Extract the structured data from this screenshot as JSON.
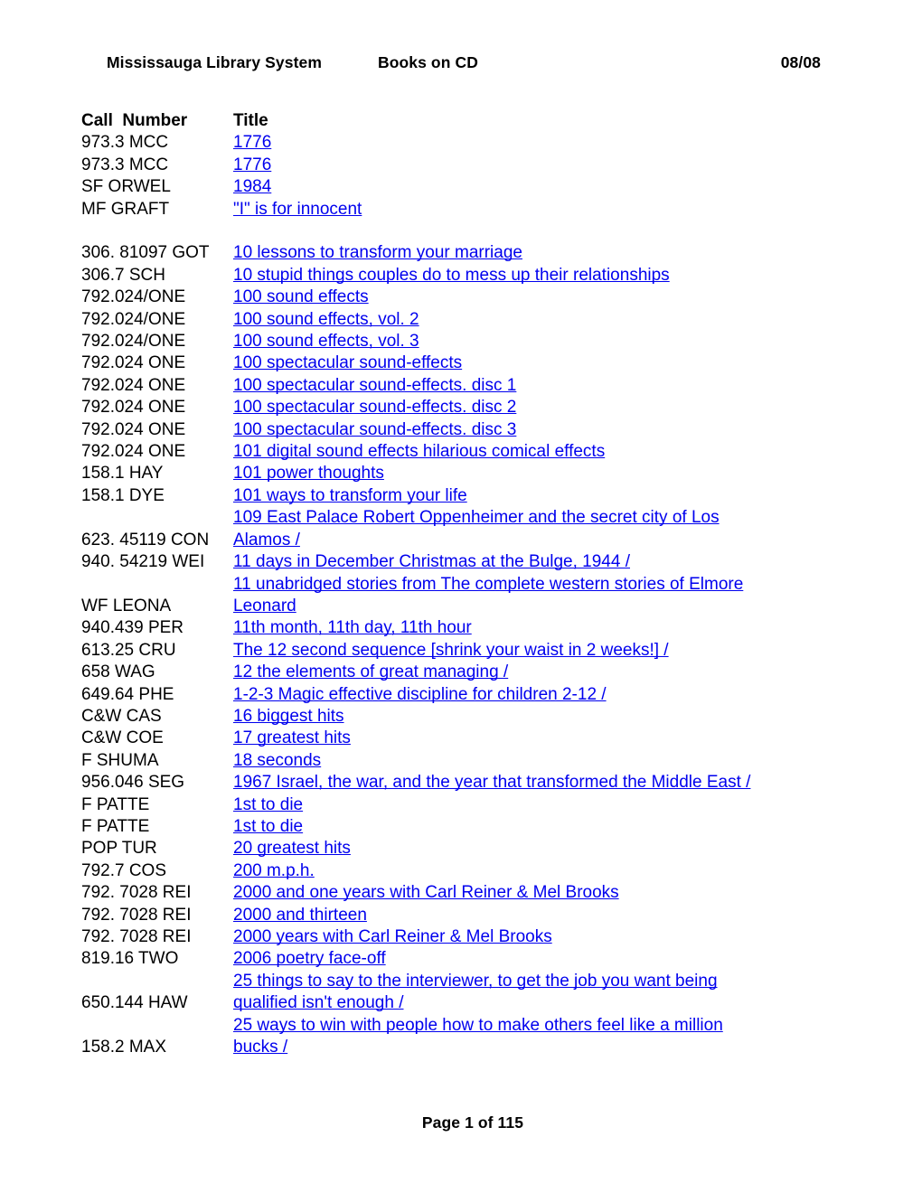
{
  "header": {
    "system_name": "Mississauga Library System",
    "report_name": "Books on CD",
    "date": "08/08"
  },
  "table": {
    "columns": {
      "call_number": "Call  Number",
      "title": "Title"
    },
    "rows": [
      {
        "call": "973.3 MCC",
        "title": "1776"
      },
      {
        "call": "973.3 MCC",
        "title": "1776"
      },
      {
        "call": "SF ORWEL",
        "title": "1984"
      },
      {
        "call": "MF GRAFT",
        "title": "\"I\" is for innocent"
      },
      {
        "spacer": true
      },
      {
        "call": "306. 81097 GOT",
        "title": "10 lessons to transform your marriage"
      },
      {
        "call": "306.7 SCH",
        "title": "10 stupid things couples do to mess up their relationships"
      },
      {
        "call": "792.024/ONE",
        "title": "100 sound effects"
      },
      {
        "call": "792.024/ONE",
        "title": "100 sound effects, vol. 2"
      },
      {
        "call": "792.024/ONE",
        "title": "100 sound effects, vol. 3"
      },
      {
        "call": "792.024 ONE",
        "title": "100 spectacular sound-effects"
      },
      {
        "call": "792.024 ONE",
        "title": "100 spectacular sound-effects. disc 1"
      },
      {
        "call": "792.024 ONE",
        "title": "100 spectacular sound-effects. disc 2"
      },
      {
        "call": "792.024 ONE",
        "title": "100 spectacular sound-effects. disc 3"
      },
      {
        "call": "792.024 ONE",
        "title": "101 digital sound effects hilarious comical effects"
      },
      {
        "call": "158.1 HAY",
        "title": "101 power thoughts"
      },
      {
        "call": "158.1 DYE",
        "title": "101 ways to transform your life"
      },
      {
        "call": "623. 45119 CON",
        "title": "109 East Palace Robert Oppenheimer and the secret city of Los Alamos /"
      },
      {
        "call": "940. 54219 WEI",
        "title": "11 days in December Christmas at the Bulge, 1944 /"
      },
      {
        "call": "WF LEONA",
        "title": "11 unabridged stories from The complete western stories of Elmore Leonard"
      },
      {
        "call": "940.439 PER",
        "title": "11th month, 11th day, 11th hour"
      },
      {
        "call": "613.25 CRU",
        "title": "The 12 second sequence [shrink your waist in 2 weeks!] /"
      },
      {
        "call": "658 WAG",
        "title": "12 the elements of great managing /"
      },
      {
        "call": "649.64 PHE",
        "title": "1-2-3 Magic effective discipline for children 2-12 /"
      },
      {
        "call": "C&W CAS",
        "title": "16 biggest hits"
      },
      {
        "call": "C&W COE",
        "title": "17 greatest hits"
      },
      {
        "call": "F SHUMA",
        "title": "18 seconds"
      },
      {
        "call": "956.046 SEG",
        "title": "1967 Israel, the war, and the year that transformed the Middle East /"
      },
      {
        "call": "F PATTE",
        "title": "1st to die"
      },
      {
        "call": "F PATTE",
        "title": "1st to die"
      },
      {
        "call": "POP TUR",
        "title": "20 greatest hits"
      },
      {
        "call": "792.7 COS",
        "title": "200 m.p.h."
      },
      {
        "call": "792. 7028 REI",
        "title": "2000 and one years with Carl Reiner & Mel Brooks"
      },
      {
        "call": "792. 7028 REI",
        "title": "2000 and thirteen"
      },
      {
        "call": "792. 7028 REI",
        "title": "2000 years with Carl Reiner & Mel Brooks"
      },
      {
        "call": "819.16 TWO",
        "title": "2006 poetry face-off"
      },
      {
        "call": "650.144 HAW",
        "title": "25 things to say to the interviewer, to get the job you want being qualified isn't enough /"
      },
      {
        "call": "158.2 MAX",
        "title": "25 ways to win with people how to make others feel like a million bucks /"
      }
    ]
  },
  "footer": {
    "page_label": "Page 1 of 115"
  },
  "colors": {
    "link": "#0000ee",
    "text": "#000000",
    "background": "#ffffff"
  }
}
